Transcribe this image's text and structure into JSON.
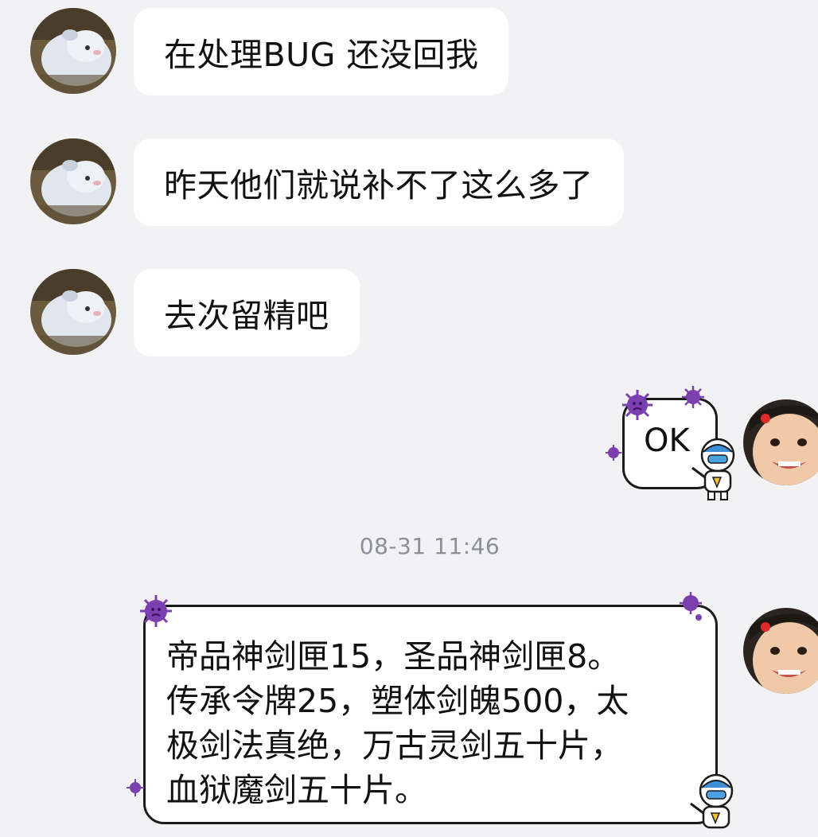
{
  "messages": [
    {
      "sender": "other",
      "avatar": "lamb-avatar",
      "text": "在处理BUG 还没回我"
    },
    {
      "sender": "other",
      "avatar": "lamb-avatar",
      "text": "昨天他们就说补不了这么多了"
    },
    {
      "sender": "other",
      "avatar": "lamb-avatar",
      "text": "去次留精吧"
    },
    {
      "sender": "me",
      "avatar": "child-avatar",
      "text": "OK"
    },
    {
      "sender": "me",
      "avatar": "child-avatar",
      "lines": [
        "帝品神剑匣15，圣品神剑匣8。",
        "传承令牌25，塑体剑魄500，太",
        "极剑法真绝，万古灵剑五十片，",
        "血狱魔剑五十片。"
      ]
    }
  ],
  "timestamp": "08-31 11:46",
  "colors": {
    "background": "#f2f2f4",
    "incoming_bubble": "#ffffff",
    "virus_purple": "#7b3fb0",
    "timestamp_text": "#8a8f99"
  },
  "icons": [
    "virus-sticker-icon",
    "doctor-mascot-icon"
  ]
}
